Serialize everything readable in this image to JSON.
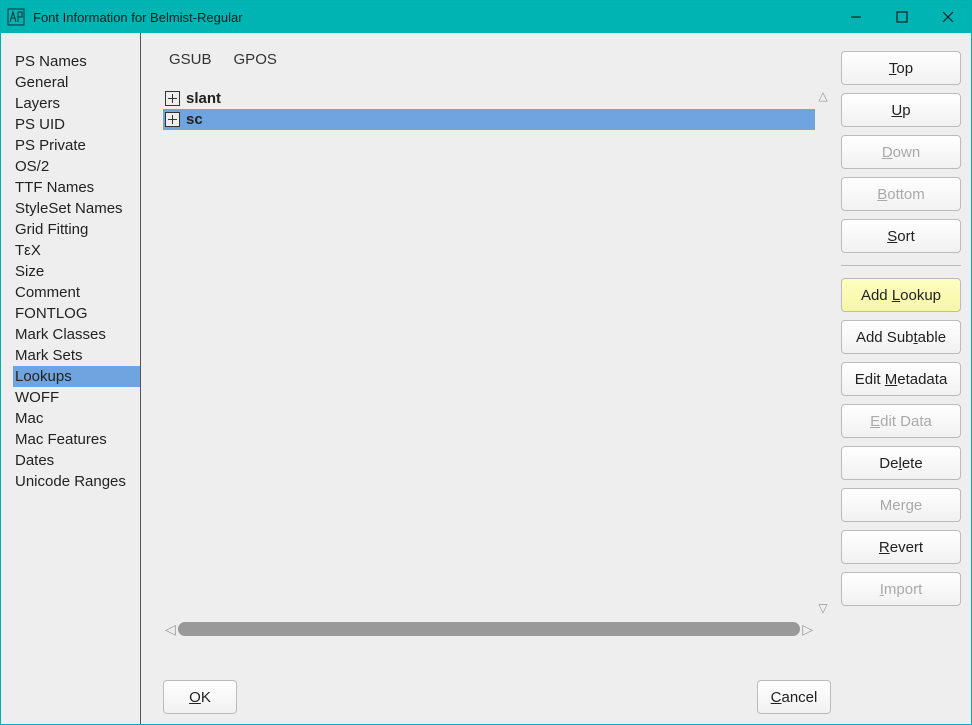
{
  "window": {
    "title": "Font Information for Belmist-Regular"
  },
  "sidebar": {
    "items": [
      {
        "label": "PS Names"
      },
      {
        "label": "General"
      },
      {
        "label": "Layers"
      },
      {
        "label": "PS UID"
      },
      {
        "label": "PS Private"
      },
      {
        "label": "OS/2"
      },
      {
        "label": "TTF Names"
      },
      {
        "label": "StyleSet Names"
      },
      {
        "label": "Grid Fitting"
      },
      {
        "label": "TεX"
      },
      {
        "label": "Size"
      },
      {
        "label": "Comment"
      },
      {
        "label": "FONTLOG"
      },
      {
        "label": "Mark Classes"
      },
      {
        "label": "Mark Sets"
      },
      {
        "label": "Lookups",
        "selected": true
      },
      {
        "label": "WOFF"
      },
      {
        "label": "Mac"
      },
      {
        "label": "Mac Features"
      },
      {
        "label": "Dates"
      },
      {
        "label": "Unicode Ranges"
      }
    ]
  },
  "tabs": {
    "items": [
      {
        "label": "GSUB",
        "active": true
      },
      {
        "label": "GPOS"
      }
    ]
  },
  "lookups": {
    "rows": [
      {
        "name": "slant",
        "selected": false
      },
      {
        "name": "sc",
        "selected": true
      }
    ]
  },
  "buttons": {
    "top": {
      "pre": "",
      "key": "T",
      "post": "op",
      "disabled": false
    },
    "up": {
      "pre": "",
      "key": "U",
      "post": "p",
      "disabled": false
    },
    "down": {
      "pre": "",
      "key": "D",
      "post": "own",
      "disabled": true
    },
    "bottom": {
      "pre": "",
      "key": "B",
      "post": "ottom",
      "disabled": true
    },
    "sort": {
      "pre": "",
      "key": "S",
      "post": "ort",
      "disabled": false
    },
    "add_lookup": {
      "pre": "Add ",
      "key": "L",
      "post": "ookup",
      "disabled": false,
      "highlight": true
    },
    "add_subtable": {
      "pre": "Add Sub",
      "key": "t",
      "post": "able",
      "disabled": false
    },
    "edit_metadata": {
      "pre": "Edit ",
      "key": "M",
      "post": "etadata",
      "disabled": false
    },
    "edit_data": {
      "pre": "",
      "key": "E",
      "post": "dit Data",
      "disabled": true
    },
    "delete": {
      "pre": "De",
      "key": "l",
      "post": "ete",
      "disabled": false
    },
    "merge": {
      "pre": "Mer",
      "key": "g",
      "post": "e",
      "disabled": true
    },
    "revert": {
      "pre": "",
      "key": "R",
      "post": "evert",
      "disabled": false
    },
    "import": {
      "pre": "",
      "key": "I",
      "post": "mport",
      "disabled": true
    }
  },
  "footer": {
    "ok": {
      "pre": "",
      "key": "O",
      "post": "K"
    },
    "cancel": {
      "pre": "",
      "key": "C",
      "post": "ancel"
    }
  }
}
